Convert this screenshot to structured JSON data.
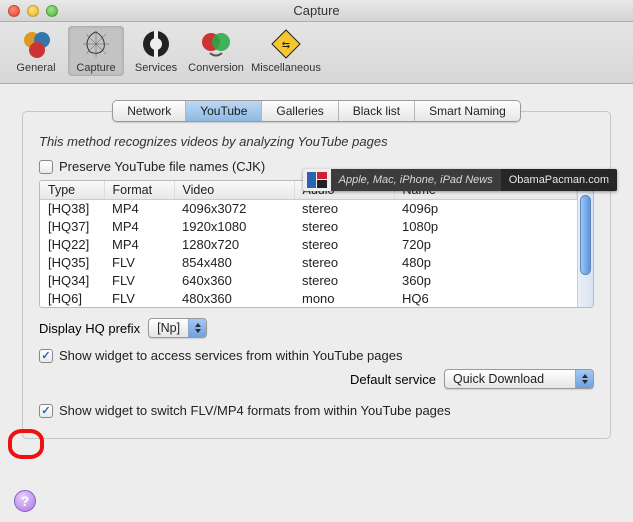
{
  "window": {
    "title": "Capture"
  },
  "toolbar": {
    "items": [
      {
        "label": "General"
      },
      {
        "label": "Capture",
        "selected": true
      },
      {
        "label": "Services"
      },
      {
        "label": "Conversion"
      },
      {
        "label": "Miscellaneous"
      }
    ]
  },
  "tabs": {
    "items": [
      "Network",
      "YouTube",
      "Galleries",
      "Black list",
      "Smart Naming"
    ],
    "active": 1
  },
  "youtube": {
    "desc": "This method recognizes videos by analyzing YouTube pages",
    "preserve_cjk_label": "Preserve YouTube file names (CJK)",
    "preserve_cjk_checked": false,
    "columns": [
      "Type",
      "Format",
      "Video",
      "Audio",
      "Name"
    ],
    "rows": [
      {
        "type": "[HQ38]",
        "format": "MP4",
        "video": "4096x3072",
        "audio": "stereo",
        "name": "4096p"
      },
      {
        "type": "[HQ37]",
        "format": "MP4",
        "video": "1920x1080",
        "audio": "stereo",
        "name": "1080p"
      },
      {
        "type": "[HQ22]",
        "format": "MP4",
        "video": "1280x720",
        "audio": "stereo",
        "name": "720p"
      },
      {
        "type": "[HQ35]",
        "format": "FLV",
        "video": "854x480",
        "audio": "stereo",
        "name": "480p"
      },
      {
        "type": "[HQ34]",
        "format": "FLV",
        "video": "640x360",
        "audio": "stereo",
        "name": "360p"
      },
      {
        "type": "[HQ6]",
        "format": "FLV",
        "video": "480x360",
        "audio": "mono",
        "name": "HQ6"
      }
    ],
    "display_prefix_label": "Display HQ prefix",
    "display_prefix_value": "[Np]",
    "show_widget_services_label": "Show widget to access services from within YouTube pages",
    "show_widget_services_checked": true,
    "default_service_label": "Default service",
    "default_service_value": "Quick Download",
    "show_widget_format_label": "Show widget to switch FLV/MP4 formats from within YouTube pages",
    "show_widget_format_checked": true
  },
  "overlay": {
    "text": "Apple, Mac, iPhone, iPad News",
    "site": "ObamaPacman.com"
  },
  "help": "?"
}
